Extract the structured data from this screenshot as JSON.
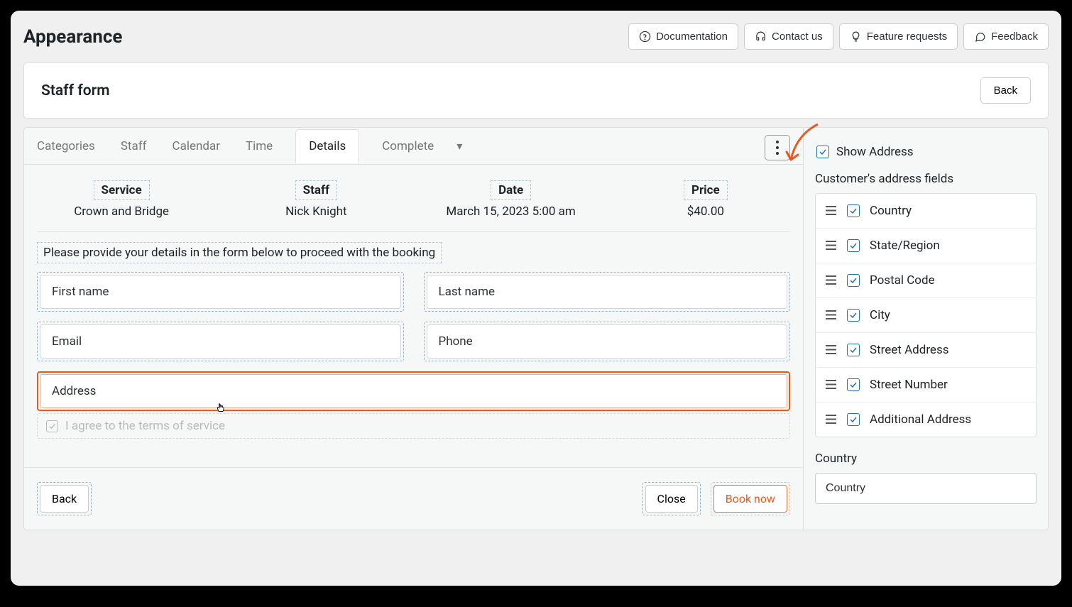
{
  "page": {
    "title": "Appearance"
  },
  "top_buttons": {
    "documentation": "Documentation",
    "contact": "Contact us",
    "feature": "Feature requests",
    "feedback": "Feedback"
  },
  "staff_card": {
    "title": "Staff form",
    "back": "Back"
  },
  "tabs": {
    "categories": "Categories",
    "staff": "Staff",
    "calendar": "Calendar",
    "time": "Time",
    "details": "Details",
    "complete": "Complete"
  },
  "summary": {
    "service_label": "Service",
    "service_value": "Crown and Bridge",
    "staff_label": "Staff",
    "staff_value": "Nick Knight",
    "date_label": "Date",
    "date_value": "March 15, 2023 5:00 am",
    "price_label": "Price",
    "price_value": "$40.00"
  },
  "form": {
    "instruction": "Please provide your details in the form below to proceed with the booking",
    "first_name": "First name",
    "last_name": "Last name",
    "email": "Email",
    "phone": "Phone",
    "address": "Address",
    "terms": "I agree to the terms of service"
  },
  "footer": {
    "back": "Back",
    "close": "Close",
    "book": "Book now"
  },
  "sidebar": {
    "show_address": "Show Address",
    "section_title": "Customer's address fields",
    "fields": {
      "country": "Country",
      "state": "State/Region",
      "postal": "Postal Code",
      "city": "City",
      "street_addr": "Street Address",
      "street_num": "Street Number",
      "additional": "Additional Address"
    },
    "country_label": "Country",
    "country_input": "Country"
  }
}
